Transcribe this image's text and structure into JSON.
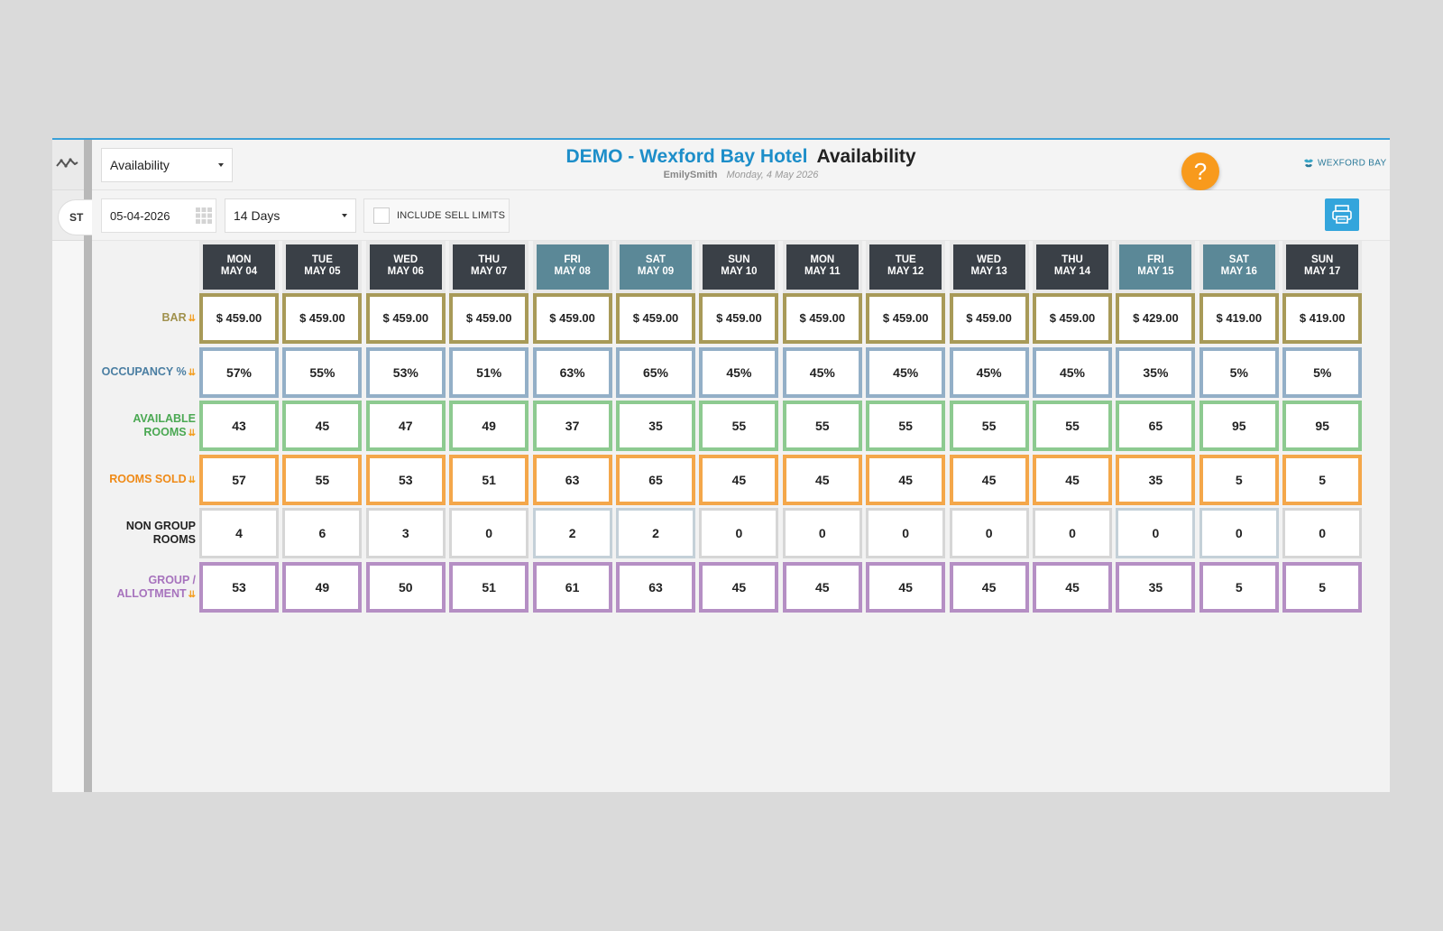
{
  "sidebar": {
    "status_label": "ST"
  },
  "header": {
    "view_select": "Availability",
    "hotel_name": "DEMO - Wexford Bay Hotel",
    "page_name": "Availability",
    "user_name": "EmilySmith",
    "date_text": "Monday, 4 May 2026",
    "help_label": "?",
    "brand_name": "WEXFORD BAY"
  },
  "toolbar": {
    "date_value": "05-04-2026",
    "range_select": "14 Days",
    "sell_limits_label": "INCLUDE SELL LIMITS",
    "sell_limits_checked": false
  },
  "colors": {
    "bar": "#a89a58",
    "occupancy": "#93afc7",
    "available": "#8dca90",
    "sold": "#f4a74a",
    "non_group": "#d6d6d6",
    "non_group_weekend": "#c4d0d8",
    "group": "#b58fc4",
    "label_bar": "#a0914d",
    "label_occupancy": "#4a7ea2",
    "label_available": "#4aa852",
    "label_sold": "#ef8a17",
    "label_non_group": "#222222",
    "label_group": "#a773bd",
    "arrow": "#f39c1c"
  },
  "days": [
    {
      "dow": "MON",
      "date": "MAY 04",
      "weekend": false
    },
    {
      "dow": "TUE",
      "date": "MAY 05",
      "weekend": false
    },
    {
      "dow": "WED",
      "date": "MAY 06",
      "weekend": false
    },
    {
      "dow": "THU",
      "date": "MAY 07",
      "weekend": false
    },
    {
      "dow": "FRI",
      "date": "MAY 08",
      "weekend": true
    },
    {
      "dow": "SAT",
      "date": "MAY 09",
      "weekend": true
    },
    {
      "dow": "SUN",
      "date": "MAY 10",
      "weekend": false
    },
    {
      "dow": "MON",
      "date": "MAY 11",
      "weekend": false
    },
    {
      "dow": "TUE",
      "date": "MAY 12",
      "weekend": false
    },
    {
      "dow": "WED",
      "date": "MAY 13",
      "weekend": false
    },
    {
      "dow": "THU",
      "date": "MAY 14",
      "weekend": false
    },
    {
      "dow": "FRI",
      "date": "MAY 15",
      "weekend": true
    },
    {
      "dow": "SAT",
      "date": "MAY 16",
      "weekend": true
    },
    {
      "dow": "SUN",
      "date": "MAY 17",
      "weekend": false
    }
  ],
  "rows": [
    {
      "key": "bar",
      "label": [
        "BAR"
      ],
      "expandable": true,
      "values": [
        "$ 459.00",
        "$ 459.00",
        "$ 459.00",
        "$ 459.00",
        "$ 459.00",
        "$ 459.00",
        "$ 459.00",
        "$ 459.00",
        "$ 459.00",
        "$ 459.00",
        "$ 459.00",
        "$ 429.00",
        "$ 419.00",
        "$ 419.00"
      ]
    },
    {
      "key": "occupancy",
      "label": [
        "OCCUPANCY %"
      ],
      "expandable": true,
      "values": [
        "57%",
        "55%",
        "53%",
        "51%",
        "63%",
        "65%",
        "45%",
        "45%",
        "45%",
        "45%",
        "45%",
        "35%",
        "5%",
        "5%"
      ]
    },
    {
      "key": "available",
      "label": [
        "AVAILABLE",
        "ROOMS"
      ],
      "expandable": true,
      "values": [
        "43",
        "45",
        "47",
        "49",
        "37",
        "35",
        "55",
        "55",
        "55",
        "55",
        "55",
        "65",
        "95",
        "95"
      ]
    },
    {
      "key": "sold",
      "label": [
        "ROOMS SOLD"
      ],
      "expandable": true,
      "values": [
        "57",
        "55",
        "53",
        "51",
        "63",
        "65",
        "45",
        "45",
        "45",
        "45",
        "45",
        "35",
        "5",
        "5"
      ]
    },
    {
      "key": "non_group",
      "label": [
        "NON GROUP",
        "ROOMS"
      ],
      "expandable": false,
      "values": [
        "4",
        "6",
        "3",
        "0",
        "2",
        "2",
        "0",
        "0",
        "0",
        "0",
        "0",
        "0",
        "0",
        "0"
      ]
    },
    {
      "key": "group",
      "label": [
        "GROUP /",
        "ALLOTMENT"
      ],
      "expandable": true,
      "values": [
        "53",
        "49",
        "50",
        "51",
        "61",
        "63",
        "45",
        "45",
        "45",
        "45",
        "45",
        "35",
        "5",
        "5"
      ]
    }
  ]
}
